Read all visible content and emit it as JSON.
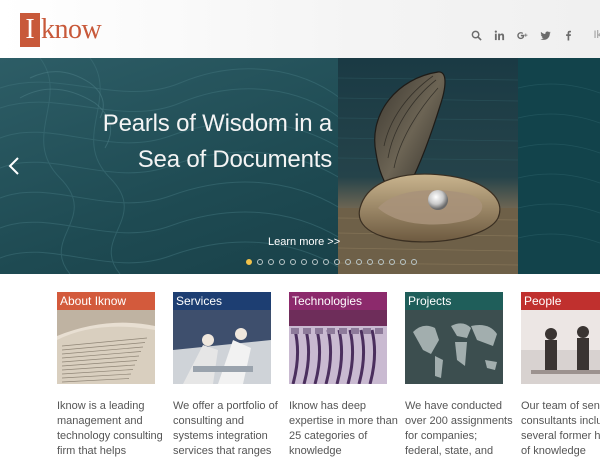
{
  "logo": {
    "box_letter": "I",
    "text": "know"
  },
  "header": {
    "icons": [
      "search-icon",
      "linkedin-icon",
      "google-plus-icon",
      "twitter-icon",
      "facebook-icon"
    ],
    "language": "Ik"
  },
  "hero": {
    "title_line1": "Pearls of Wisdom in a",
    "title_line2": "Sea of Documents",
    "learn_more": "Learn more >>",
    "slide_count": 16,
    "active_slide": 1,
    "colors": {
      "sea": "#1f4850",
      "sand": "#c7b08a",
      "active_dot": "#f1c24a"
    }
  },
  "cards": [
    {
      "title": "About Iknow",
      "color": "#d35a3c",
      "text1": "Iknow is a leading",
      "text2": "management and",
      "text3": "technology consulting",
      "text4": "firm that helps"
    },
    {
      "title": "Services",
      "color": "#1d3e72",
      "text1": "We offer a portfolio of",
      "text2": "consulting and",
      "text3": "systems integration",
      "text4": "services that ranges"
    },
    {
      "title": "Technologies",
      "color": "#8c2a6c",
      "text1": "Iknow has deep",
      "text2": "expertise in more than",
      "text3": "25 categories of",
      "text4": "knowledge"
    },
    {
      "title": "Projects",
      "color": "#1f5e5a",
      "text1": "We have conducted",
      "text2": "over 200 assignments",
      "text3": "for companies;",
      "text4": "federal, state, and"
    },
    {
      "title": "People",
      "color": "#c0302e",
      "text1": "Our team of senior",
      "text2": "consultants include",
      "text3": "several former heads",
      "text4": "of knowledge"
    }
  ]
}
